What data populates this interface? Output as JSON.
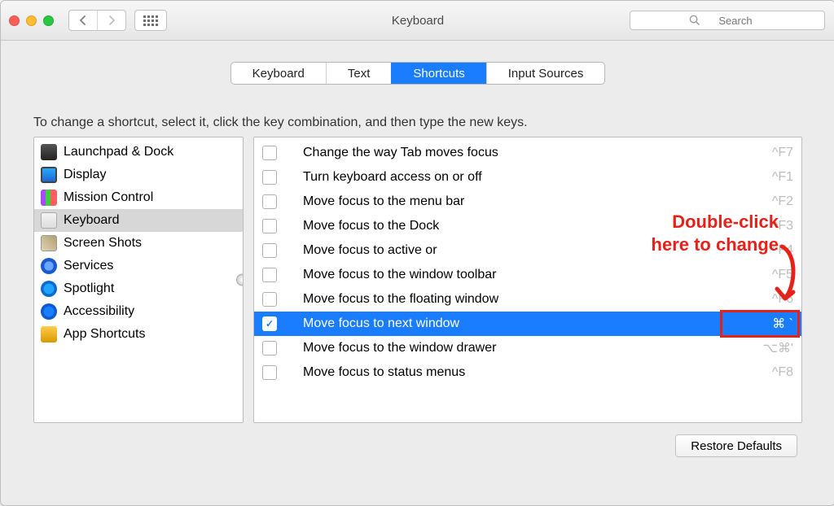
{
  "window": {
    "title": "Keyboard",
    "search_placeholder": "Search"
  },
  "tabs": [
    {
      "label": "Keyboard",
      "selected": false
    },
    {
      "label": "Text",
      "selected": false
    },
    {
      "label": "Shortcuts",
      "selected": true
    },
    {
      "label": "Input Sources",
      "selected": false
    }
  ],
  "instruction": "To change a shortcut, select it, click the key combination, and then type the new keys.",
  "categories": [
    {
      "label": "Launchpad & Dock",
      "icon": "ic-launchpad",
      "selected": false
    },
    {
      "label": "Display",
      "icon": "ic-display",
      "selected": false
    },
    {
      "label": "Mission Control",
      "icon": "ic-mission",
      "selected": false
    },
    {
      "label": "Keyboard",
      "icon": "ic-keyboard",
      "selected": true
    },
    {
      "label": "Screen Shots",
      "icon": "ic-screenshots",
      "selected": false
    },
    {
      "label": "Services",
      "icon": "ic-services",
      "selected": false
    },
    {
      "label": "Spotlight",
      "icon": "ic-spotlight",
      "selected": false
    },
    {
      "label": "Accessibility",
      "icon": "ic-access",
      "selected": false
    },
    {
      "label": "App Shortcuts",
      "icon": "ic-appsc",
      "selected": false
    }
  ],
  "shortcuts": [
    {
      "label": "Change the way Tab moves focus",
      "key": "^F7",
      "checked": false,
      "selected": false
    },
    {
      "label": "Turn keyboard access on or off",
      "key": "^F1",
      "checked": false,
      "selected": false
    },
    {
      "label": "Move focus to the menu bar",
      "key": "^F2",
      "checked": false,
      "selected": false
    },
    {
      "label": "Move focus to the Dock",
      "key": "^F3",
      "checked": false,
      "selected": false
    },
    {
      "label": "Move focus to active or",
      "key": "^F4",
      "checked": false,
      "selected": false
    },
    {
      "label": "Move focus to the window toolbar",
      "key": "^F5",
      "checked": false,
      "selected": false
    },
    {
      "label": "Move focus to the floating window",
      "key": "^F6",
      "checked": false,
      "selected": false
    },
    {
      "label": "Move focus to next window",
      "key": "⌘ `",
      "checked": true,
      "selected": true
    },
    {
      "label": "Move focus to the window drawer",
      "key": "⌥⌘'",
      "checked": false,
      "selected": false
    },
    {
      "label": "Move focus to status menus",
      "key": "^F8",
      "checked": false,
      "selected": false
    }
  ],
  "annotation": {
    "line1": "Double-click",
    "line2": "here to change"
  },
  "footer": {
    "restore": "Restore Defaults"
  }
}
